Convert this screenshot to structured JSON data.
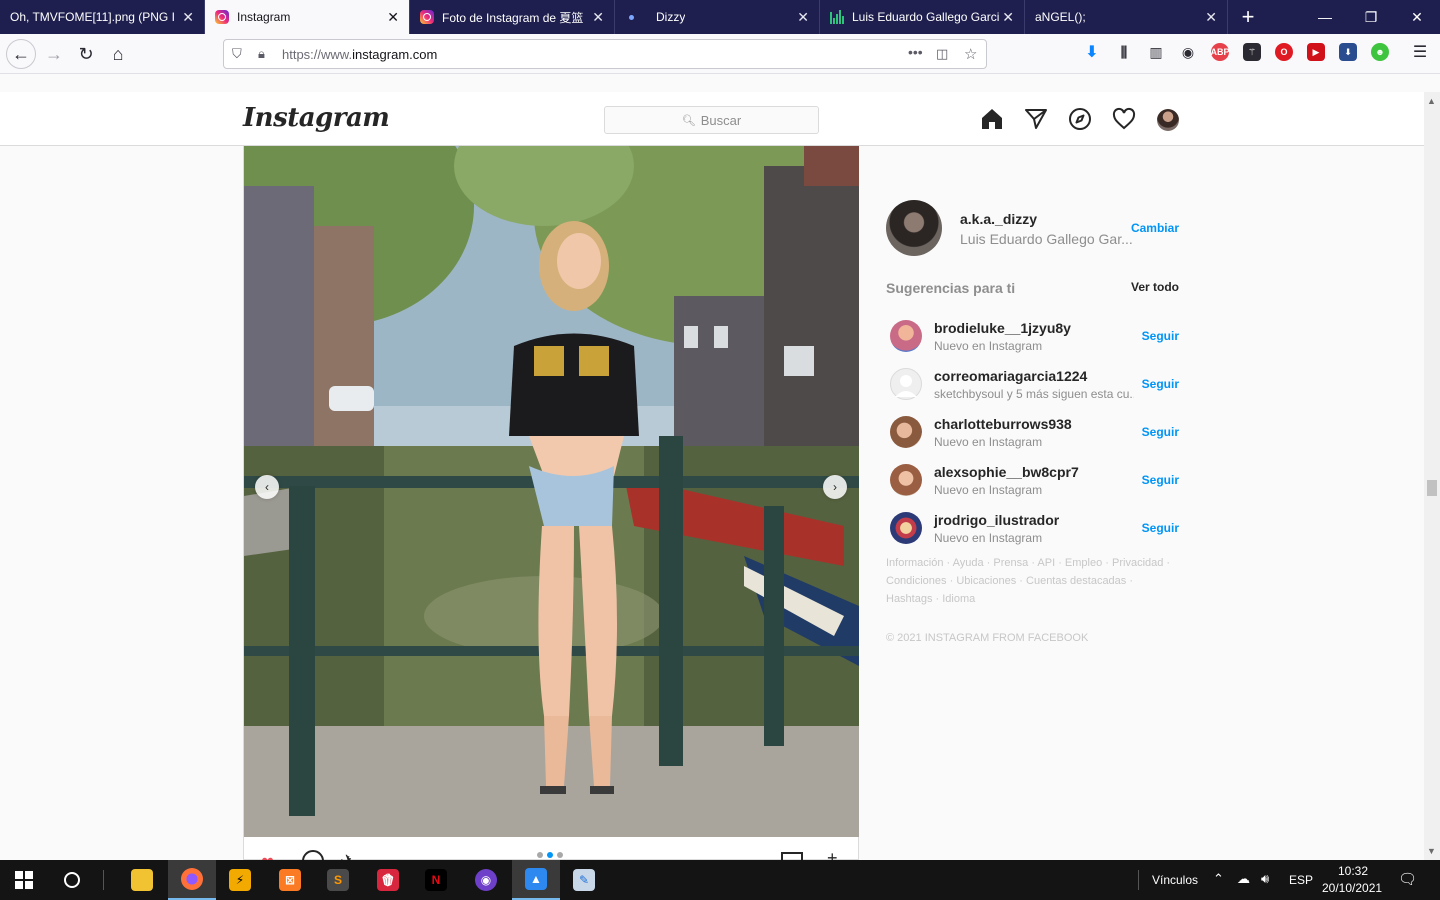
{
  "browser": {
    "tabs": [
      {
        "title": "Oh, TMVFOME[11].png (PNG In",
        "icon": "image-icon"
      },
      {
        "title": "Instagram",
        "icon": "instagram-icon",
        "active": true
      },
      {
        "title": "Foto de Instagram de 夏篮",
        "icon": "instagram-icon"
      },
      {
        "title": "Dizzy",
        "icon": "dot-icon"
      },
      {
        "title": "Luis Eduardo Gallego Garci",
        "icon": "bars-icon"
      },
      {
        "title": "aNGEL();",
        "icon": "none"
      }
    ],
    "new_tab": "+",
    "url_scheme": "https://www.",
    "url_host": "instagram.com",
    "page_actions": "•••"
  },
  "instagram": {
    "logo": "Instagram",
    "search_placeholder": "Buscar",
    "me": {
      "username": "a.k.a._dizzy",
      "name": "Luis Eduardo Gallego Gar...",
      "switch": "Cambiar"
    },
    "suggestions_title": "Sugerencias para ti",
    "see_all": "Ver todo",
    "suggestions": [
      {
        "username": "brodieluke__1jzyu8y",
        "sub": "Nuevo en Instagram",
        "action": "Seguir",
        "avatar_color": "#c96a86"
      },
      {
        "username": "correomariagarcia1224",
        "sub": "sketchbysoul y 5 más siguen esta cu...",
        "action": "Seguir",
        "avatar_color": "#e6e6e6"
      },
      {
        "username": "charlotteburrows938",
        "sub": "Nuevo en Instagram",
        "action": "Seguir",
        "avatar_color": "#a8745a"
      },
      {
        "username": "alexsophie__bw8cpr7",
        "sub": "Nuevo en Instagram",
        "action": "Seguir",
        "avatar_color": "#b07a62"
      },
      {
        "username": "jrodrigo_ilustrador",
        "sub": "Nuevo en Instagram",
        "action": "Seguir",
        "avatar_color": "#4c5a8a"
      }
    ],
    "footer_line1": "Información · Ayuda · Prensa · API · Empleo · Privacidad ·",
    "footer_line2": "Condiciones · Ubicaciones · Cuentas destacadas ·",
    "footer_line3": "Hashtags · Idioma",
    "copyright": "© 2021 INSTAGRAM FROM FACEBOOK"
  },
  "taskbar": {
    "links_label": "Vínculos",
    "language": "ESP",
    "time": "10:32",
    "date": "20/10/2021"
  }
}
